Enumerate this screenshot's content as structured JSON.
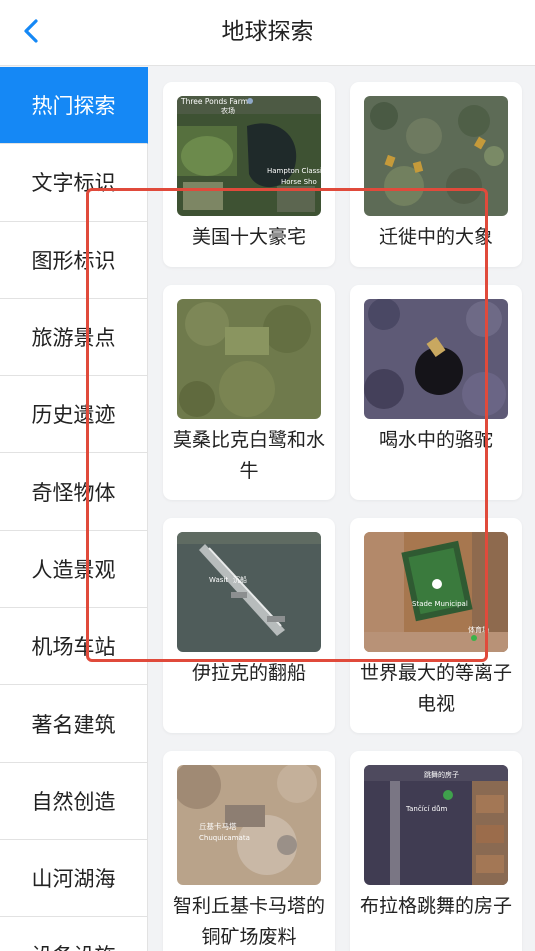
{
  "header": {
    "title": "地球探索",
    "back_icon": "chevron-left-icon"
  },
  "colors": {
    "accent": "#1588f5",
    "annotation_box": "#e04a3b"
  },
  "sidebar": {
    "items": [
      {
        "label": "热门探索",
        "active": true
      },
      {
        "label": "文字标识"
      },
      {
        "label": "图形标识"
      },
      {
        "label": "旅游景点"
      },
      {
        "label": "历史遗迹"
      },
      {
        "label": "奇怪物体"
      },
      {
        "label": "人造景观"
      },
      {
        "label": "机场车站"
      },
      {
        "label": "著名建筑"
      },
      {
        "label": "自然创造"
      },
      {
        "label": "山河湖海"
      },
      {
        "label": "设备设施"
      }
    ]
  },
  "cards": [
    {
      "label": "美国十大豪宅",
      "map_labels": [
        "Three Ponds Farm",
        "农场",
        "Hampton Classic",
        "Horse Sho"
      ]
    },
    {
      "label": "迁徙中的大象"
    },
    {
      "label": "莫桑比克白鹭和水牛"
    },
    {
      "label": "喝水中的骆驼"
    },
    {
      "label": "伊拉克的翻船",
      "map_labels": [
        "Wasit",
        "沉船"
      ]
    },
    {
      "label": "世界最大的等离子电视",
      "map_labels": [
        "Stade Municipal",
        "体育场"
      ]
    },
    {
      "label": "智利丘基卡马塔的铜矿场废料",
      "map_labels": [
        "丘基卡马塔",
        "Chuquicamata"
      ]
    },
    {
      "label": "布拉格跳舞的房子",
      "map_labels": [
        "跳舞的房子",
        "Tančící dům"
      ]
    }
  ]
}
